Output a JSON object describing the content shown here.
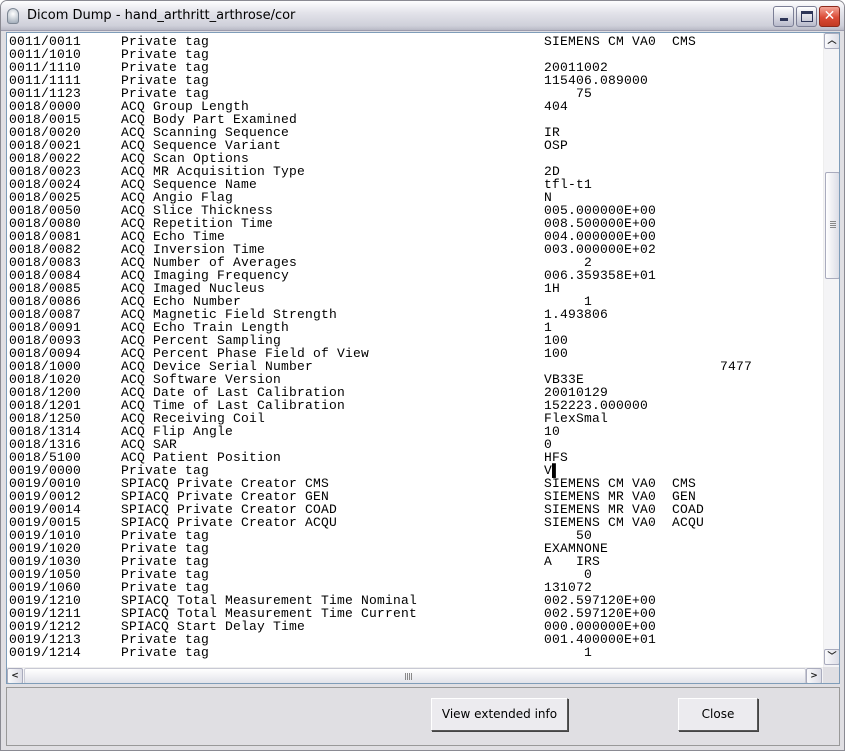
{
  "window": {
    "title": "Dicom Dump - hand_arthritt_arthrose/cor",
    "icon": "dicom-app-icon"
  },
  "rows": [
    [
      "0011/0011",
      "Private tag",
      "SIEMENS CM VA0  CMS"
    ],
    [
      "0011/1010",
      "Private tag",
      ""
    ],
    [
      "0011/1110",
      "Private tag",
      "20011002"
    ],
    [
      "0011/1111",
      "Private tag",
      "115406.089000"
    ],
    [
      "0011/1123",
      "Private tag",
      "    75"
    ],
    [
      "0018/0000",
      "ACQ Group Length",
      "404"
    ],
    [
      "0018/0015",
      "ACQ Body Part Examined",
      ""
    ],
    [
      "0018/0020",
      "ACQ Scanning Sequence",
      "IR"
    ],
    [
      "0018/0021",
      "ACQ Sequence Variant",
      "OSP"
    ],
    [
      "0018/0022",
      "ACQ Scan Options",
      ""
    ],
    [
      "0018/0023",
      "ACQ MR Acquisition Type",
      "2D"
    ],
    [
      "0018/0024",
      "ACQ Sequence Name",
      "tfl-t1"
    ],
    [
      "0018/0025",
      "ACQ Angio Flag",
      "N"
    ],
    [
      "0018/0050",
      "ACQ Slice Thickness",
      "005.000000E+00"
    ],
    [
      "0018/0080",
      "ACQ Repetition Time",
      "008.500000E+00"
    ],
    [
      "0018/0081",
      "ACQ Echo Time",
      "004.000000E+00"
    ],
    [
      "0018/0082",
      "ACQ Inversion Time",
      "003.000000E+02"
    ],
    [
      "0018/0083",
      "ACQ Number of Averages",
      "     2"
    ],
    [
      "0018/0084",
      "ACQ Imaging Frequency",
      "006.359358E+01"
    ],
    [
      "0018/0085",
      "ACQ Imaged Nucleus",
      "1H"
    ],
    [
      "0018/0086",
      "ACQ Echo Number",
      "     1"
    ],
    [
      "0018/0087",
      "ACQ Magnetic Field Strength",
      "1.493806"
    ],
    [
      "0018/0091",
      "ACQ Echo Train Length",
      "1"
    ],
    [
      "0018/0093",
      "ACQ Percent Sampling",
      "100"
    ],
    [
      "0018/0094",
      "ACQ Percent Phase Field of View",
      "100"
    ],
    [
      "0018/1000",
      "ACQ Device Serial Number",
      "                      7477"
    ],
    [
      "0018/1020",
      "ACQ Software Version",
      "VB33E"
    ],
    [
      "0018/1200",
      "ACQ Date of Last Calibration",
      "20010129"
    ],
    [
      "0018/1201",
      "ACQ Time of Last Calibration",
      "152223.000000"
    ],
    [
      "0018/1250",
      "ACQ Receiving Coil",
      "FlexSmal"
    ],
    [
      "0018/1314",
      "ACQ Flip Angle",
      "10"
    ],
    [
      "0018/1316",
      "ACQ SAR",
      "0"
    ],
    [
      "0018/5100",
      "ACQ Patient Position",
      "HFS"
    ],
    [
      "0019/0000",
      "Private tag",
      "V▌"
    ],
    [
      "0019/0010",
      "SPIACQ Private Creator CMS",
      "SIEMENS CM VA0  CMS"
    ],
    [
      "0019/0012",
      "SPIACQ Private Creator GEN",
      "SIEMENS MR VA0  GEN"
    ],
    [
      "0019/0014",
      "SPIACQ Private Creator COAD",
      "SIEMENS MR VA0  COAD"
    ],
    [
      "0019/0015",
      "SPIACQ Private Creator ACQU",
      "SIEMENS CM VA0  ACQU"
    ],
    [
      "0019/1010",
      "Private tag",
      "    50"
    ],
    [
      "0019/1020",
      "Private tag",
      "EXAMNONE"
    ],
    [
      "0019/1030",
      "Private tag",
      "A   IRS"
    ],
    [
      "0019/1050",
      "Private tag",
      "     0"
    ],
    [
      "0019/1060",
      "Private tag",
      "131072"
    ],
    [
      "0019/1210",
      "SPIACQ Total Measurement Time Nominal",
      "002.597120E+00"
    ],
    [
      "0019/1211",
      "SPIACQ Total Measurement Time Current",
      "002.597120E+00"
    ],
    [
      "0019/1212",
      "SPIACQ Start Delay Time",
      "000.000000E+00"
    ],
    [
      "0019/1213",
      "Private tag",
      "001.400000E+01"
    ],
    [
      "0019/1214",
      "Private tag",
      "     1"
    ]
  ],
  "buttons": {
    "extended": "View extended info",
    "close": "Close"
  },
  "colors": {
    "close_button": "#db4b36",
    "list_border": "#7f9db9",
    "panel": "#e0dfe3"
  }
}
